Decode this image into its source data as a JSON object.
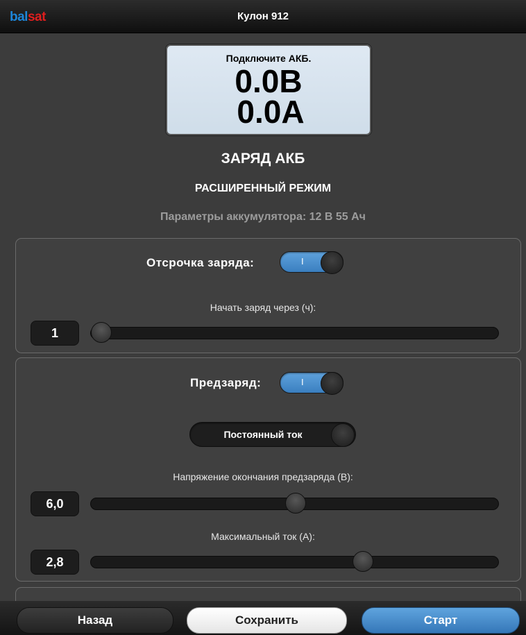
{
  "header": {
    "logo_part1": "bal",
    "logo_part2": "sat",
    "title": "Кулон 912"
  },
  "display": {
    "message": "Подключите АКБ.",
    "voltage": "0.0В",
    "current": "0.0А"
  },
  "mode_title": "ЗАРЯД АКБ",
  "mode_subtitle": "РАСШИРЕННЫЙ РЕЖИМ",
  "battery_params": "Параметры аккумулятора: 12 В 55 Ач",
  "delay": {
    "label": "Отсрочка заряда:",
    "toggle_text": "I",
    "toggle_on": true,
    "slider_label": "Начать заряд через (ч):",
    "value": "1",
    "slider_fraction": 0.0
  },
  "precharge": {
    "label": "Предзаряд:",
    "toggle_text": "I",
    "toggle_on": true,
    "mode_select": "Постоянный ток",
    "voltage_label": "Напряжение окончания предзаряда (В):",
    "voltage_value": "6,0",
    "voltage_fraction": 0.5,
    "current_label": "Максимальный ток (А):",
    "current_value": "2,8",
    "current_fraction": 0.675
  },
  "buttons": {
    "back": "Назад",
    "save": "Сохранить",
    "start": "Старт"
  }
}
